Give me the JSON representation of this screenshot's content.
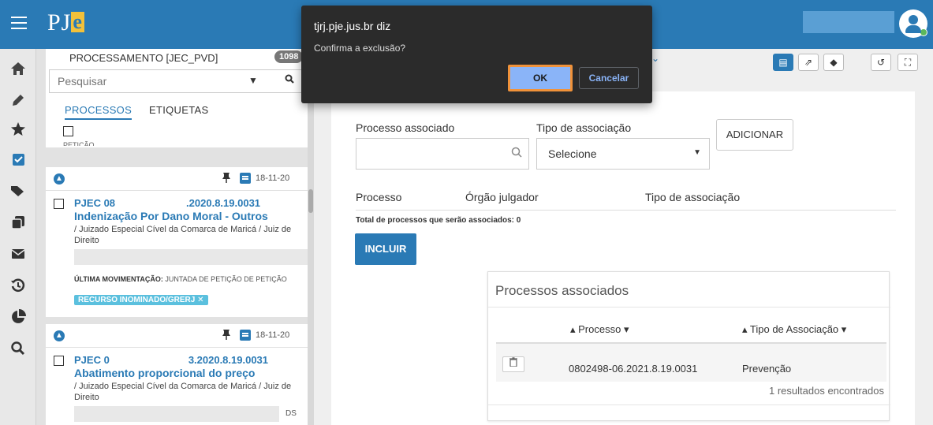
{
  "header": {
    "logo_text": "PJ",
    "logo_e": "e"
  },
  "rail": {
    "icons": [
      "home-icon",
      "pencil-icon",
      "star-icon",
      "checkbox-icon",
      "tags-icon",
      "copy-icon",
      "envelope-icon",
      "history-icon",
      "pie-chart-icon",
      "search-icon"
    ]
  },
  "list": {
    "title": "PROCESSAMENTO [JEC_PVD]",
    "count": "1098",
    "search_placeholder": "Pesquisar",
    "tabs": {
      "processos": "PROCESSOS",
      "etiquetas": "ETIQUETAS"
    },
    "cut_text": "PETIÇÃO",
    "cards": [
      {
        "date": "18-11-20",
        "num_prefix": "PJEC 08",
        "num_suffix": ".2020.8.19.0031",
        "subject": "Indenização Por Dano Moral - Outros",
        "org": "/ Juizado Especial Cível da Comarca de Maricá / Juiz de Direito",
        "mov_label": "ÚLTIMA MOVIMENTAÇÃO:",
        "mov_text": "JUNTADA DE PETIÇÃO DE PETIÇÃO",
        "tag": "RECURSO INOMINADO/GRERJ ✕"
      },
      {
        "date": "18-11-20",
        "num_prefix": "PJEC 0",
        "num_suffix": "3.2020.8.19.0031",
        "subject": "Abatimento proporcional do preço",
        "org": "/ Juizado Especial Cível da Comarca de Maricá / Juiz de Direito",
        "tail": "DS"
      }
    ]
  },
  "form": {
    "processo_label": "Processo associado",
    "tipo_label": "Tipo de associação",
    "tipo_value": "Selecione",
    "add_label": "ADICIONAR",
    "col_processo": "Processo",
    "col_orgao": "Órgão julgador",
    "col_tipo": "Tipo de associação",
    "total": "Total de processos que serão associados: 0",
    "incluir": "INCLUIR"
  },
  "associados": {
    "title": "Processos associados",
    "col_processo": "▴ Processo ▾",
    "col_tipo": "▴ Tipo de Associação ▾",
    "rows": [
      {
        "processo": "0802498-06.2021.8.19.0031",
        "tipo": "Prevenção"
      }
    ],
    "results": "1 resultados encontrados"
  },
  "dialog": {
    "title": "tjrj.pje.jus.br diz",
    "message": "Confirma a exclusão?",
    "ok": "OK",
    "cancel": "Cancelar"
  },
  "colors": {
    "primary": "#2a7ab5",
    "dialog_bg": "#2b2b2b",
    "highlight": "#f0923a"
  }
}
